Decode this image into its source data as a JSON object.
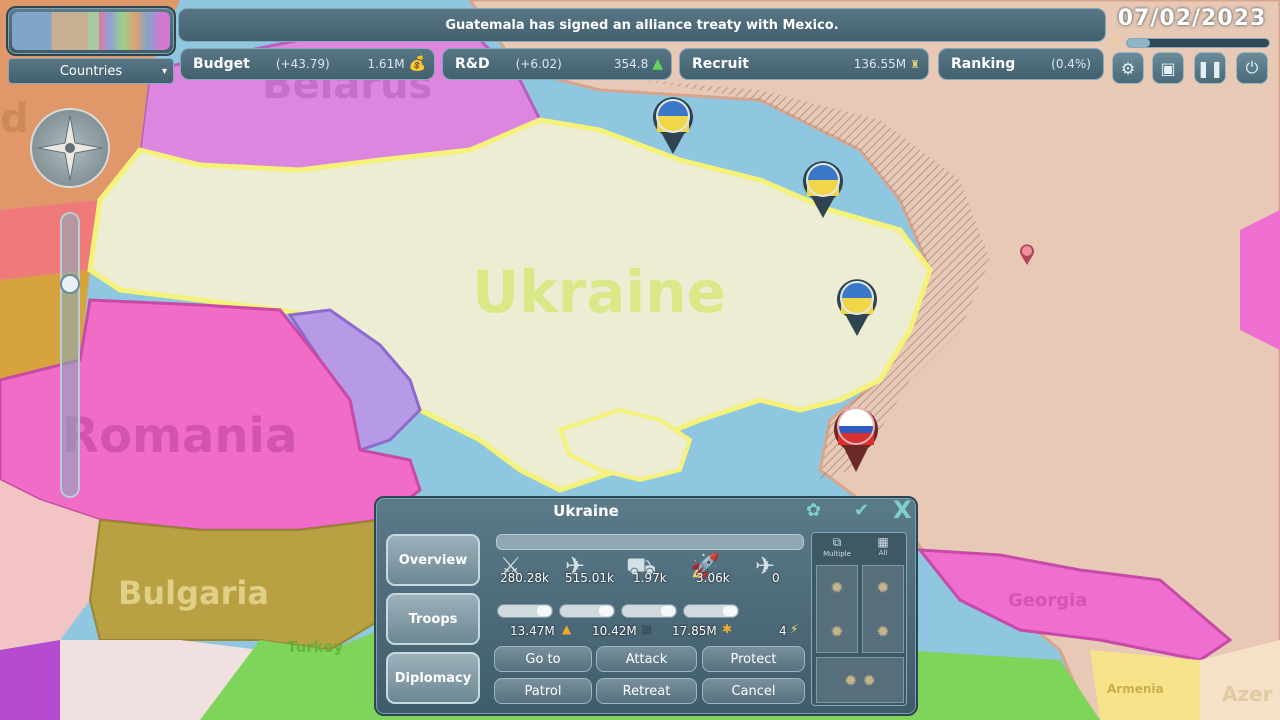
{
  "notification": "Guatemala has signed an alliance treaty with Mexico.",
  "date": "07/02/2023",
  "view_selector": "Countries",
  "colors": {
    "ukraine": "#ecedd3",
    "russia": "#e8c9b5",
    "belarus": "#dc86e0",
    "romania": "#f06cc6",
    "moldova": "#b79ae6",
    "bulgaria": "#b8a043",
    "turkey": "#7fd45a",
    "georgia": "#ef6fd0",
    "sea": "#8fc6e0",
    "panel": "#4b6a78"
  },
  "stats": {
    "budget": {
      "label": "Budget",
      "delta": "(+43.79)",
      "value": "1.61M"
    },
    "rnd": {
      "label": "R&D",
      "delta": "(+6.02)",
      "value": "354.8"
    },
    "recruit": {
      "label": "Recruit",
      "value": "136.55M"
    },
    "ranking": {
      "label": "Ranking",
      "value": "(0.4%)"
    }
  },
  "top_icons": [
    "gear-icon",
    "save-icon",
    "pause-icon",
    "power-icon"
  ],
  "map_labels": {
    "ukraine": "Ukraine",
    "romania": "Romania",
    "bulgaria": "Bulgaria",
    "belarus": "Belarus",
    "turkey": "Turkey",
    "georgia": "Georgia",
    "armenia": "Armenia",
    "azer": "Azer",
    "partial": "d"
  },
  "panel": {
    "title": "Ukraine",
    "tabs": [
      "Overview",
      "Troops",
      "Diplomacy"
    ],
    "units": [
      {
        "icon": "infantry-icon",
        "count": "280.28k"
      },
      {
        "icon": "artillery-icon",
        "count": "515.01k"
      },
      {
        "icon": "tank-icon",
        "count": "1.97k"
      },
      {
        "icon": "missile-launcher-icon",
        "count": "3.06k"
      },
      {
        "icon": "aircraft-icon",
        "count": "0"
      }
    ],
    "resources": [
      {
        "value": "13.47M",
        "icon": "ammo-icon"
      },
      {
        "value": "10.42M",
        "icon": "fuel-icon"
      },
      {
        "value": "17.85M",
        "icon": "supply-icon"
      },
      {
        "value": "4",
        "icon": "energy-icon"
      }
    ],
    "actions": [
      "Go to",
      "Attack",
      "Protect",
      "Patrol",
      "Retreat",
      "Cancel"
    ],
    "select_labels": {
      "multiple": "Multiple",
      "all": "All"
    }
  }
}
